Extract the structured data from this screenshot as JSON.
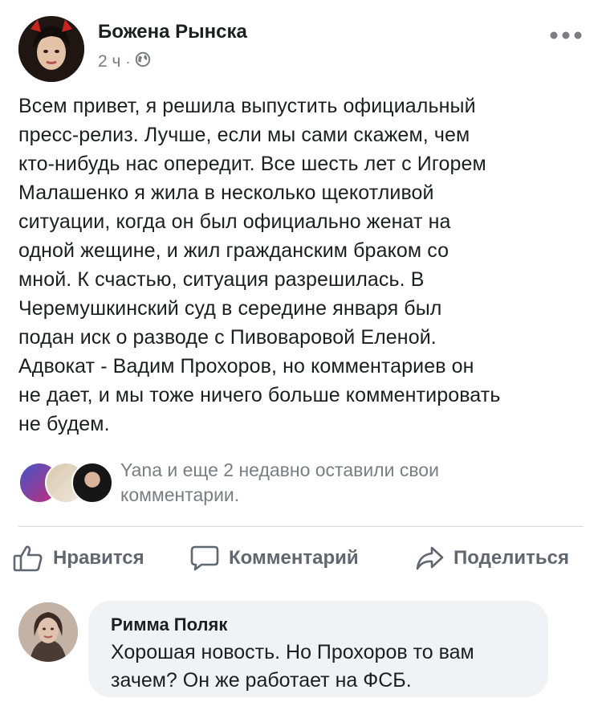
{
  "post": {
    "author": "Божена Рынска",
    "time": "2 ч",
    "separator": "·",
    "privacy_icon": "globe-icon",
    "more_icon": "ellipsis-icon",
    "text": "Всем привет, я решила выпустить официальный\nпресс-релиз. Лучше, если мы сами скажем, чем\nкто-нибудь нас опередит. Все шесть лет с Игорем\nМалашенко я жила в несколько щекотливой\nситуации, когда он был официально женат на\nодной жещине, и жил гражданским браком со\nмной. К счастью, ситуация разрешилась. В\nЧеремушкинский суд в середине января был\nподан иск о разводе с Пивоваровой Еленой.\nАдвокат  - Вадим Прохоров, но комментариев он\nне дает, и мы тоже ничего больше комментировать\nне будем."
  },
  "activity": {
    "text": "Yana и еще 2 недавно оставили свои\nкомментарии."
  },
  "actions": {
    "like_label": "Нравится",
    "comment_label": "Комментарий",
    "share_label": "Поделиться",
    "like_icon": "thumbs-up-icon",
    "comment_icon": "speech-bubble-icon",
    "share_icon": "share-arrow-icon"
  },
  "comment": {
    "author": "Римма Поляк",
    "text": "Хорошая новость. Но Прохоров то вам зачем? Он же работает на ФСБ."
  },
  "colors": {
    "text": "#1c1e21",
    "secondary_text": "#7a7d82",
    "action_gray": "#606770",
    "bubble_bg": "#f0f2f5",
    "divider": "#d5d7db"
  }
}
